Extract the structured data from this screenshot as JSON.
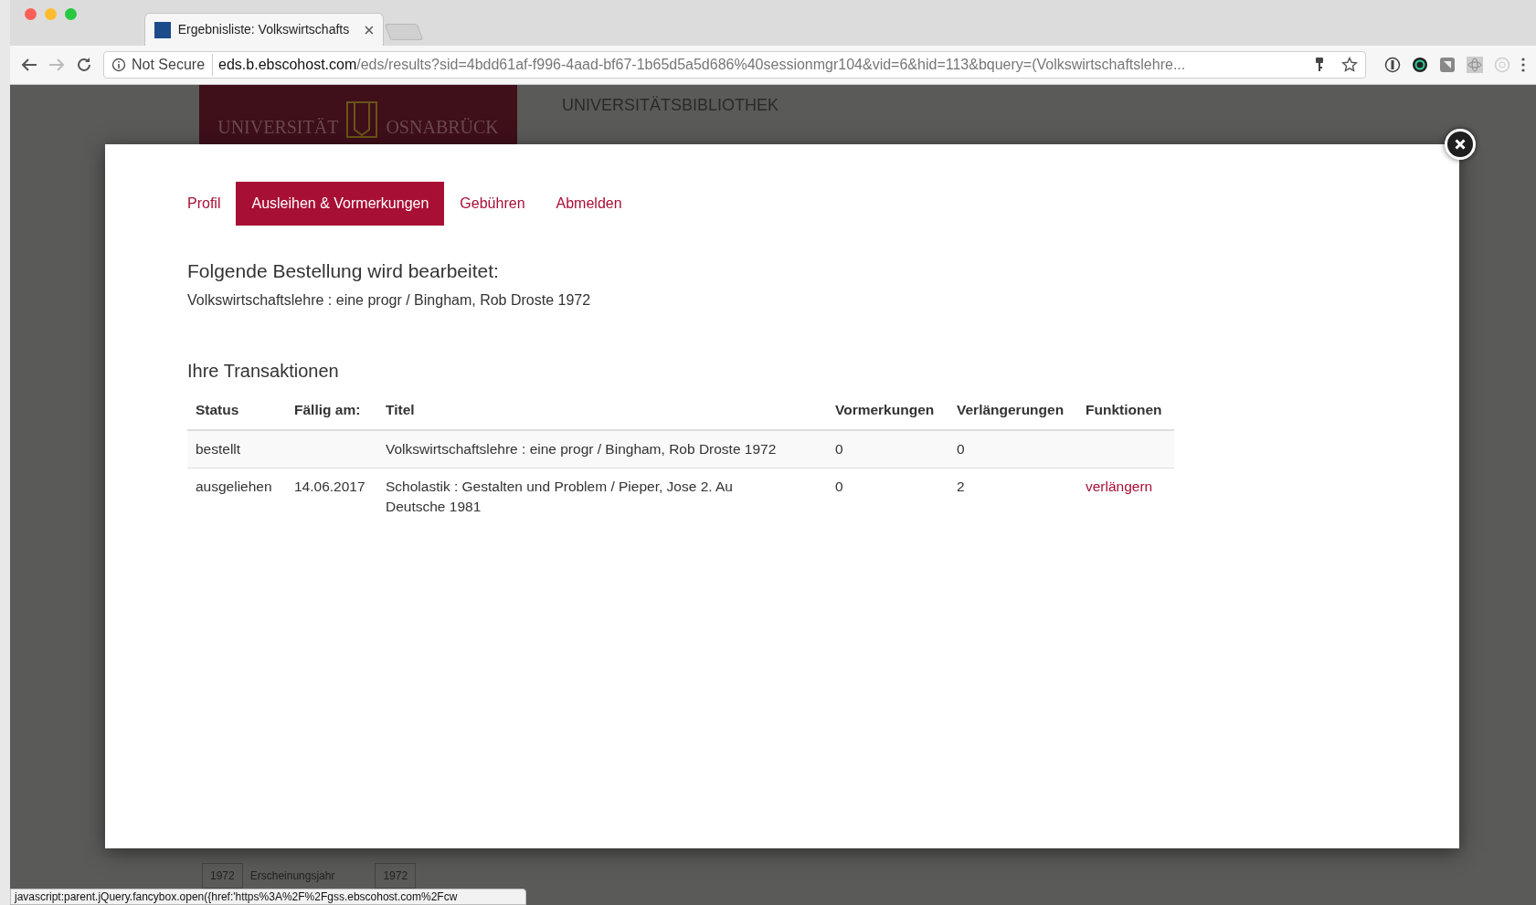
{
  "browser": {
    "tab_title": "Ergebnisliste: Volkswirtschafts",
    "security": "Not Secure",
    "url_host": "eds.b.ebscohost.com",
    "url_path": "/eds/results?sid=4bdd61af-f996-4aad-bf67-1b65d5a5d686%40sessionmgr104&vid=6&hid=113&bquery=(Volkswirtschaftslehre..."
  },
  "background": {
    "logo_words": [
      "UNIVERSITÄT",
      "OSNABRÜCK"
    ],
    "library": "UNIVERSITÄTSBIBLIOTHEK",
    "facet": [
      "1972",
      "Erscheinungsjahr",
      "1972"
    ]
  },
  "modal": {
    "tabs": [
      {
        "label": "Profil",
        "selected": false
      },
      {
        "label": "Ausleihen & Vormerkungen",
        "selected": true
      },
      {
        "label": "Gebühren",
        "selected": false
      },
      {
        "label": "Abmelden",
        "selected": false
      }
    ],
    "order_heading": "Folgende Bestellung wird bearbeitet:",
    "order_text": "Volkswirtschaftslehre : eine progr / Bingham, Rob Droste 1972",
    "transactions_heading": "Ihre Transaktionen",
    "table": {
      "columns": [
        "Status",
        "Fällig am:",
        "Titel",
        "Vormerkungen",
        "Verlängerungen",
        "Funktionen"
      ],
      "rows": [
        {
          "status": "bestellt",
          "due": "",
          "title": "Volkswirtschaftslehre : eine progr / Bingham, Rob Droste 1972",
          "reservations": "0",
          "renewals": "0",
          "action": ""
        },
        {
          "status": "ausgeliehen",
          "due": "14.06.2017",
          "title": "Scholastik : Gestalten und Problem / Pieper, Jose 2. Au Deutsche 1981",
          "reservations": "0",
          "renewals": "2",
          "action": "verlängern"
        }
      ]
    }
  },
  "status_bar": "javascript:parent.jQuery.fancybox.open({href:'https%3A%2F%2Fgss.ebscohost.com%2Fcw"
}
